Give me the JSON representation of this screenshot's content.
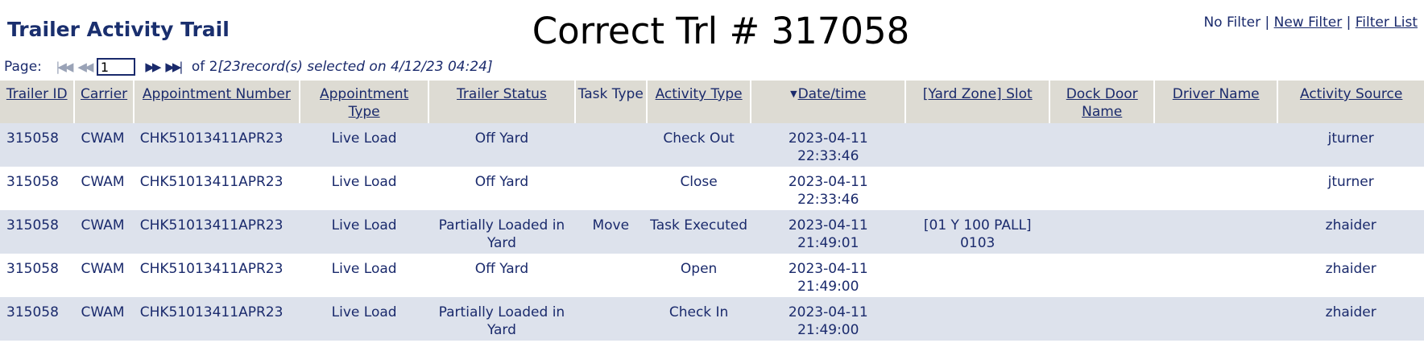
{
  "app_title": "Trailer Activity Trail",
  "page_heading": "Correct Trl # 317058",
  "filter": {
    "status": "No Filter",
    "separator": "|",
    "new_filter": "New Filter",
    "filter_list": "Filter List"
  },
  "pager": {
    "label": "Page:",
    "current_page": "1",
    "of_text": "of 2",
    "summary": "[23record(s) selected on 4/12/23 04:24]"
  },
  "columns": {
    "trailer_id": "Trailer ID",
    "carrier": "Carrier",
    "appointment_number": "Appointment Number",
    "appointment_type": "Appointment Type",
    "trailer_status": "Trailer Status",
    "task_type": "Task Type",
    "activity_type": "Activity Type",
    "date_time": "Date/time",
    "yard_zone_slot": "[Yard Zone] Slot",
    "dock_door_name": "Dock Door Name",
    "driver_name": "Driver Name",
    "activity_source": "Activity Source"
  },
  "rows": [
    {
      "trailer_id": "315058",
      "carrier": "CWAM",
      "appointment_number": "CHK51013411APR23",
      "appointment_type": "Live Load",
      "trailer_status": "Off Yard",
      "task_type": "",
      "activity_type": "Check Out",
      "date": "2023-04-11",
      "time": "22:33:46",
      "yard_zone_slot": "",
      "dock_door_name": "",
      "driver_name": "",
      "activity_source": "jturner"
    },
    {
      "trailer_id": "315058",
      "carrier": "CWAM",
      "appointment_number": "CHK51013411APR23",
      "appointment_type": "Live Load",
      "trailer_status": "Off Yard",
      "task_type": "",
      "activity_type": "Close",
      "date": "2023-04-11",
      "time": "22:33:46",
      "yard_zone_slot": "",
      "dock_door_name": "",
      "driver_name": "",
      "activity_source": "jturner"
    },
    {
      "trailer_id": "315058",
      "carrier": "CWAM",
      "appointment_number": "CHK51013411APR23",
      "appointment_type": "Live Load",
      "trailer_status": "Partially Loaded in Yard",
      "task_type": "Move",
      "activity_type": "Task Executed",
      "date": "2023-04-11",
      "time": "21:49:01",
      "yard_zone_slot": "[01 Y 100 PALL] 0103",
      "dock_door_name": "",
      "driver_name": "",
      "activity_source": "zhaider"
    },
    {
      "trailer_id": "315058",
      "carrier": "CWAM",
      "appointment_number": "CHK51013411APR23",
      "appointment_type": "Live Load",
      "trailer_status": "Off Yard",
      "task_type": "",
      "activity_type": "Open",
      "date": "2023-04-11",
      "time": "21:49:00",
      "yard_zone_slot": "",
      "dock_door_name": "",
      "driver_name": "",
      "activity_source": "zhaider"
    },
    {
      "trailer_id": "315058",
      "carrier": "CWAM",
      "appointment_number": "CHK51013411APR23",
      "appointment_type": "Live Load",
      "trailer_status": "Partially Loaded in Yard",
      "task_type": "",
      "activity_type": "Check In",
      "date": "2023-04-11",
      "time": "21:49:00",
      "yard_zone_slot": "",
      "dock_door_name": "",
      "driver_name": "",
      "activity_source": "zhaider"
    }
  ],
  "colors": {
    "header_bg": "#dddbd3",
    "row_alt_bg": "#dde2ec",
    "text": "#1a2a6c"
  }
}
